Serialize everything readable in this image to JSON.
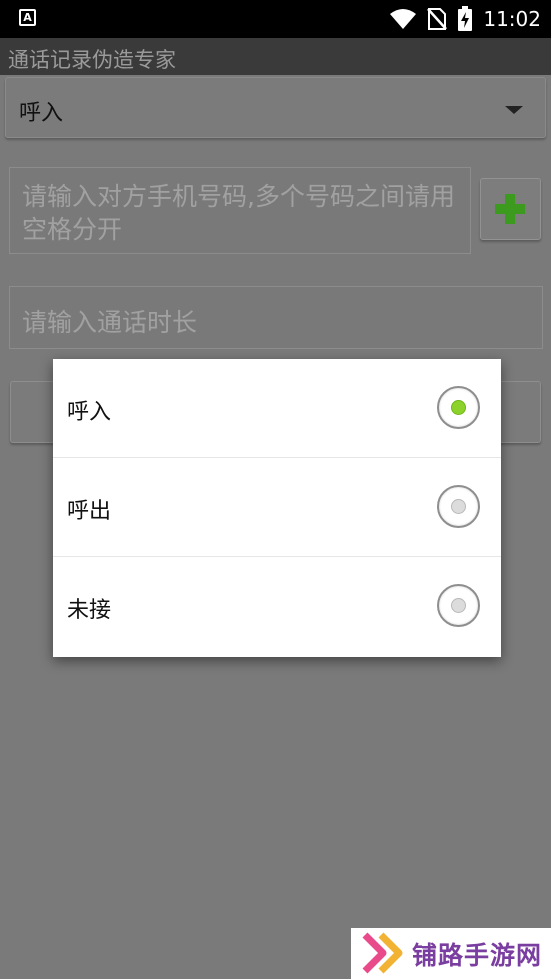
{
  "status_bar": {
    "time": "11:02",
    "notification_icon": "text-a-icon",
    "icons": [
      "wifi-icon",
      "no-sim-icon",
      "battery-charging-icon"
    ]
  },
  "app": {
    "title": "通话记录伪造专家"
  },
  "form": {
    "call_type_selected": "呼入",
    "phone_placeholder": "请输入对方手机号码,多个号码之间请用空格分开",
    "duration_placeholder": "请输入通话时长",
    "add_button_icon": "plus-icon"
  },
  "dialog": {
    "options": [
      {
        "label": "呼入",
        "selected": true
      },
      {
        "label": "呼出",
        "selected": false
      },
      {
        "label": "未接",
        "selected": false
      }
    ]
  },
  "watermark": {
    "text": "铺路手游网",
    "accent": "#7a3ea0",
    "arrow_colors": [
      "#e94b8a",
      "#f2b233"
    ]
  },
  "colors": {
    "radio_checked": "#8cd22a",
    "plus_green": "#3c9a1e"
  }
}
